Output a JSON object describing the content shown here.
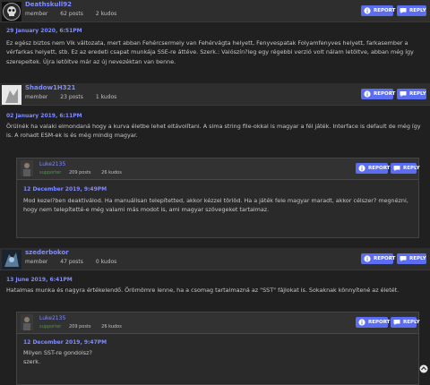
{
  "actions": {
    "report": "REPORT",
    "reply": "REPLY"
  },
  "posts": [
    {
      "username": "Deathskull92",
      "rank": "member",
      "posts": "62 posts",
      "kudos": "2 kudos",
      "date": "29 January 2020, 6:51PM",
      "text": "Ez egész biztos nem Vik változata, mert abban Fehércsermely van Fehérvágta helyett, Fenyvespatak Folyamfenyves helyett, farkasember a vérfarkas helyett, stb. Ez az eredeti csapat munkája SSE-re áttéve. Szerk.: Valószín?leg egy régebbi verzió volt nálam letöltve, abban még így szerepeltek. Újra letöltve már az új nevezéktan van benne."
    },
    {
      "username": "Shadow1H321",
      "rank": "member",
      "posts": "23 posts",
      "kudos": "1 kudos",
      "date": "02 January 2019, 6:11PM",
      "text": "Örülnék ha valaki elmondaná hogy a kurva életbe lehet eltávolítani. A sima string file-okkal is magyar a fél játék. Interface is default de még így is. A rohadt ESM-ek is és még mindig magyar.",
      "quote": {
        "username": "Luke2135",
        "rank": "supporter",
        "posts": "209 posts",
        "kudos": "26 kudos",
        "date": "12 December 2019, 9:49PM",
        "text": "Mod kezel?ben deaktiválod. Ha manuálisan telepítetted, akkor kézzel törlöd. Ha a játék fele magyar maradt, akkor célszer? megnézni, hogy nem telepítetté-e még valami más modot is, ami magyar szövegeket tartalmaz."
      }
    },
    {
      "username": "szederbokor",
      "rank": "member",
      "posts": "47 posts",
      "kudos": "0 kudos",
      "date": "13 June 2019, 6:41PM",
      "text": "Hatalmas munka és nagyra értékelendő. Örömömre lenne, ha a csomag tartalmazná az \"SST\" fájlokat is. Sokaknak könnyítené az életét.",
      "quote": {
        "username": "Luke2135",
        "rank": "supporter",
        "posts": "209 posts",
        "kudos": "26 kudos",
        "date": "12 December 2019, 9:47PM",
        "text_line1": "Milyen SST-re gondolsz?",
        "text_line2": "szerk."
      }
    }
  ],
  "colors": {
    "accent": "#5b6ef2",
    "link": "#7f8cff",
    "supporter": "#3ca23c"
  }
}
